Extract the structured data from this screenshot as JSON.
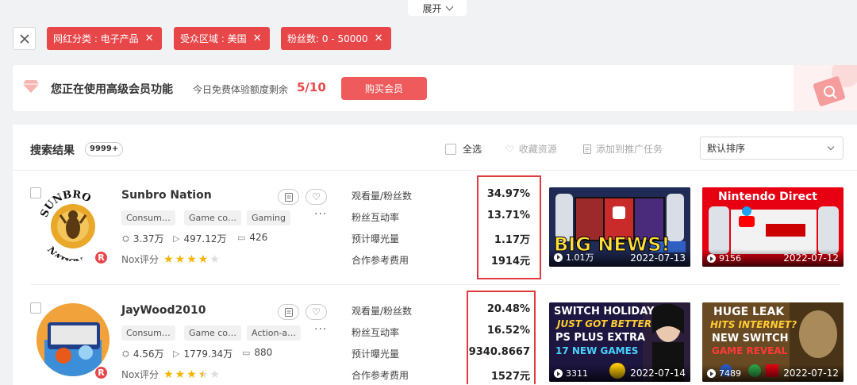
{
  "toolbar": {
    "expand_label": "展开"
  },
  "filters": [
    {
      "label": "网红分类 : 电子产品"
    },
    {
      "label": "受众区域 : 美国"
    },
    {
      "label": "粉丝数: 0 - 50000"
    }
  ],
  "banner": {
    "title": "您正在使用高级会员功能",
    "quota_label": "今日免费体验额度剩余",
    "quota_value": "5/10",
    "buy_label": "购买会员"
  },
  "results": {
    "title": "搜索结果",
    "count": "9999+",
    "select_all": "全选",
    "favorite": "收藏资源",
    "add_task": "添加到推广任务",
    "sort_value": "默认排序"
  },
  "metric_labels": [
    "观看量/粉丝数",
    "粉丝互动率",
    "预计曝光量",
    "合作参考费用"
  ],
  "rating_label": "Nox评分",
  "items": [
    {
      "name": "Sunbro Nation",
      "tags": [
        "Consum…",
        "Game co…",
        "Gaming"
      ],
      "followers": "3.37万",
      "views": "497.12万",
      "videos": "426",
      "rating": 4,
      "metrics": [
        "34.97%",
        "13.71%",
        "1.17万",
        "1914元"
      ],
      "thumbs": [
        {
          "views": "1.01万",
          "date": "2022-07-13",
          "caption": "BIG NEWS!"
        },
        {
          "views": "9156",
          "date": "2022-07-12",
          "caption": "Nintendo Direct"
        }
      ]
    },
    {
      "name": "JayWood2010",
      "tags": [
        "Consum…",
        "Game co…",
        "Action-a…"
      ],
      "followers": "4.56万",
      "views": "1779.34万",
      "videos": "880",
      "rating": 3.5,
      "metrics": [
        "20.48%",
        "16.52%",
        "9340.8667",
        "1527元"
      ],
      "thumbs": [
        {
          "views": "3311",
          "date": "2022-07-14",
          "caption_1": "SWITCH HOLIDAY",
          "caption_2": "JUST GOT BETTER",
          "caption_3": "PS PLUS EXTRA",
          "caption_4": "17 NEW GAMES"
        },
        {
          "views": "7489",
          "date": "2022-07-12",
          "caption_1": "HUGE LEAK",
          "caption_2": "HITS INTERNET?",
          "caption_3": "NEW SWITCH",
          "caption_4": "GAME REVEAL"
        }
      ]
    }
  ],
  "colors": {
    "accent": "#e8474a",
    "star": "#f5b400",
    "star_empty": "#dddddd"
  }
}
